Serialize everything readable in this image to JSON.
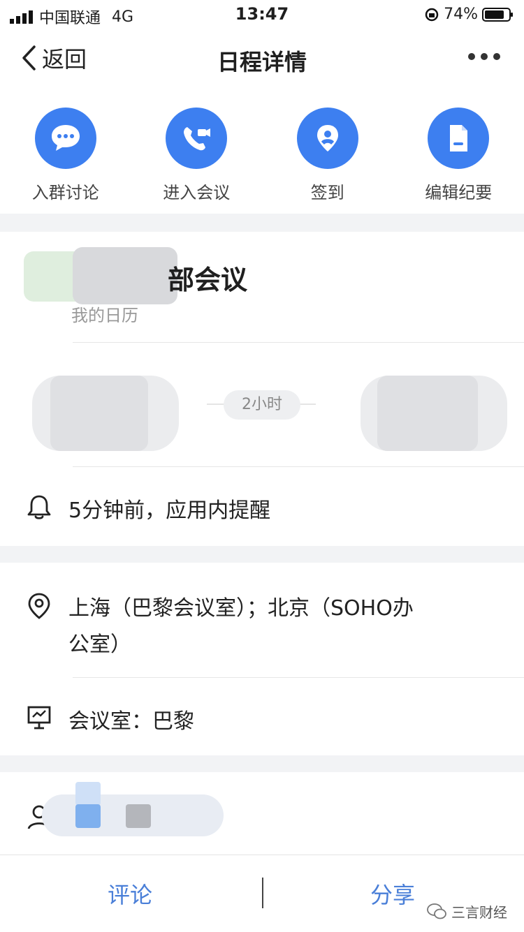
{
  "status_bar": {
    "carrier": "中国联通",
    "network": "4G",
    "time": "13:47",
    "battery": "74%"
  },
  "nav": {
    "back_label": "返回",
    "title": "日程详情"
  },
  "actions": [
    {
      "icon": "chat-icon",
      "label": "入群讨论"
    },
    {
      "icon": "video-call-icon",
      "label": "进入会议"
    },
    {
      "icon": "location-pin-icon",
      "label": "签到"
    },
    {
      "icon": "document-icon",
      "label": "编辑纪要"
    }
  ],
  "event": {
    "title": "部会议",
    "calendar": "我的日历",
    "duration": "2小时"
  },
  "reminder": "5分钟前，应用内提醒",
  "location": {
    "line1": "上海（巴黎会议室）；北京（SOHO办",
    "line2": "公室）"
  },
  "meeting_room": "会议室：巴黎",
  "bottom_bar": {
    "comment_label": "评论",
    "share_label": "分享"
  },
  "watermark": "三言财经",
  "colors": {
    "accent": "#3d7ff0",
    "bottom_link": "#4a7fd8"
  }
}
